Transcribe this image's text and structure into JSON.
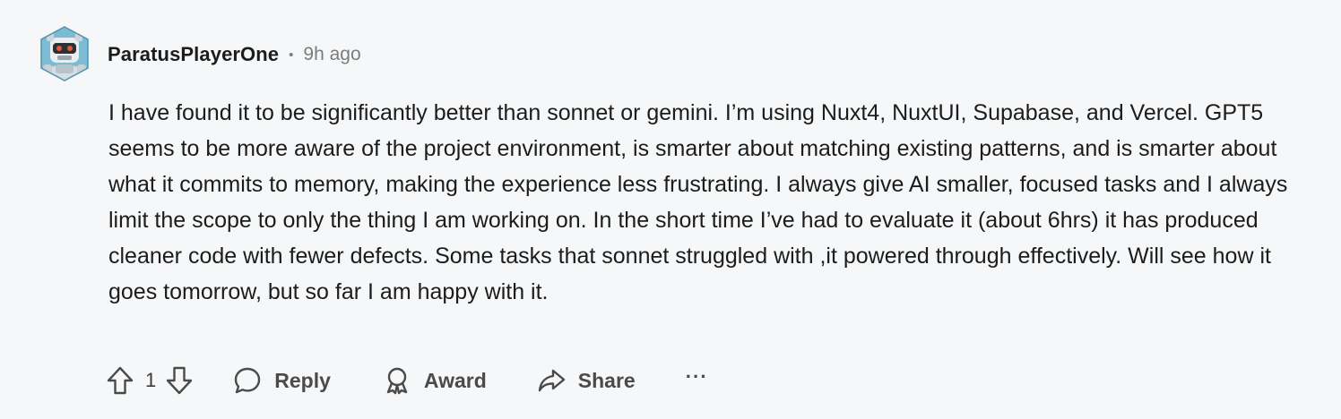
{
  "comment": {
    "author": "ParatusPlayerOne",
    "separator": "•",
    "time": "9h ago",
    "body": "I have found it to be significantly better than sonnet or gemini. I’m using Nuxt4, NuxtUI, Supabase, and Vercel. GPT5 seems to be more aware of the project environment, is smarter about matching existing patterns, and is smarter about what it commits to memory, making the experience less frustrating. I always give AI smaller, focused tasks and I always limit the scope to only the thing I am working on. In the short time I’ve had to evaluate it (about 6hrs) it has produced cleaner code with fewer defects. Some tasks that sonnet struggled with ,it powered through effectively. Will see how it goes tomorrow, but so far I am happy with it."
  },
  "actions": {
    "vote_count": "1",
    "reply_label": "Reply",
    "award_label": "Award",
    "share_label": "Share",
    "more_label": "···"
  },
  "colors": {
    "background": "#f6f7f8",
    "text": "#1c1c1c",
    "muted": "#7c7c7c",
    "icon": "#4a4a4a"
  },
  "icons": {
    "avatar": "robot-avatar",
    "upvote": "arrow-up-icon",
    "downvote": "arrow-down-icon",
    "reply": "speech-bubble-icon",
    "award": "award-ribbon-icon",
    "share": "share-arrow-icon",
    "more": "ellipsis-icon"
  }
}
